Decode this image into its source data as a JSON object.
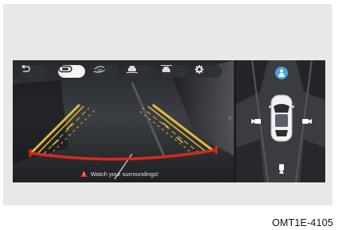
{
  "toolbar": {
    "buttons": [
      {
        "name": "back",
        "icon": "return-arrow-icon",
        "active": false
      },
      {
        "name": "rear-view",
        "icon": "rear-camera-view-icon",
        "active": true
      },
      {
        "name": "3d-view",
        "icon": "3d-rotate-icon",
        "active": false
      },
      {
        "name": "front-wide-view",
        "icon": "car-front-icon",
        "active": false
      },
      {
        "name": "rear-wide-view",
        "icon": "car-rear-icon",
        "active": false
      },
      {
        "name": "settings",
        "icon": "gear-icon",
        "active": false
      }
    ]
  },
  "rear_camera": {
    "warning_text": "Watch your surroundings!",
    "warning_icon": "warning-triangle-icon",
    "view_indicator": "F",
    "guide_colors": {
      "far": "#e0b93a",
      "near": "#d32a22"
    }
  },
  "top_view": {
    "active_camera_icon": "person-camera-icon",
    "camera_icons": [
      "left-camera-icon",
      "right-camera-icon",
      "rear-camera-icon"
    ],
    "accent": "#4aa3df"
  },
  "figure": {
    "code": "OMT1E-4105"
  }
}
